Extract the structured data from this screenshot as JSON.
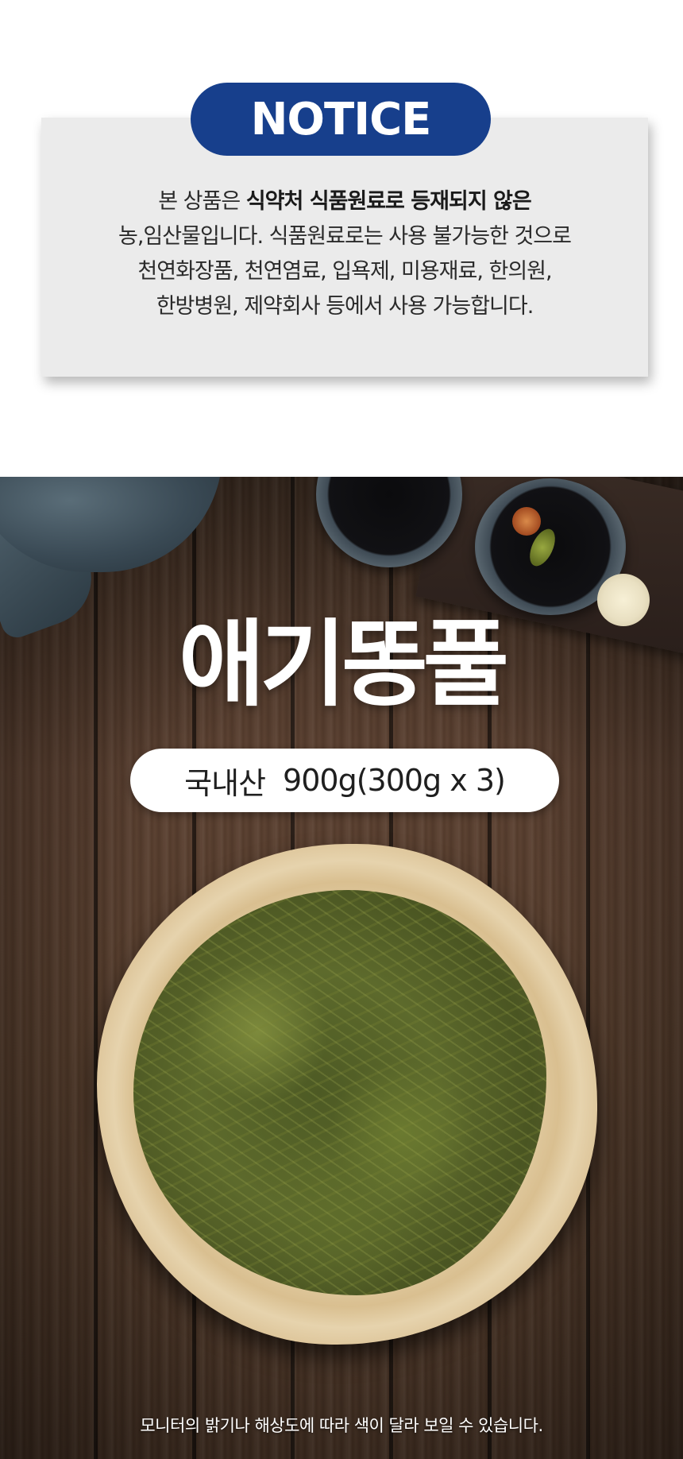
{
  "notice": {
    "badge": "NOTICE",
    "line1_normal": "본 상품은 ",
    "line1_bold": "식약처 식품원료로 등재되지 않은",
    "line2": "농,임산물입니다. 식품원료로는 사용 불가능한 것으로",
    "line3": "천연화장품, 천연염료, 입욕제, 미용재료, 한의원,",
    "line4": "한방병원, 제약회사 등에서 사용 가능합니다."
  },
  "product": {
    "title": "애기똥풀",
    "origin": "국내산",
    "spec": "900g(300g x 3)",
    "disclaimer": "모니터의 밝기나 해상도에 따라 색이 달라 보일 수 있습니다."
  },
  "colors": {
    "badge_bg": "#173f8c",
    "card_bg": "#ebebeb",
    "wood": "#4a3425"
  }
}
